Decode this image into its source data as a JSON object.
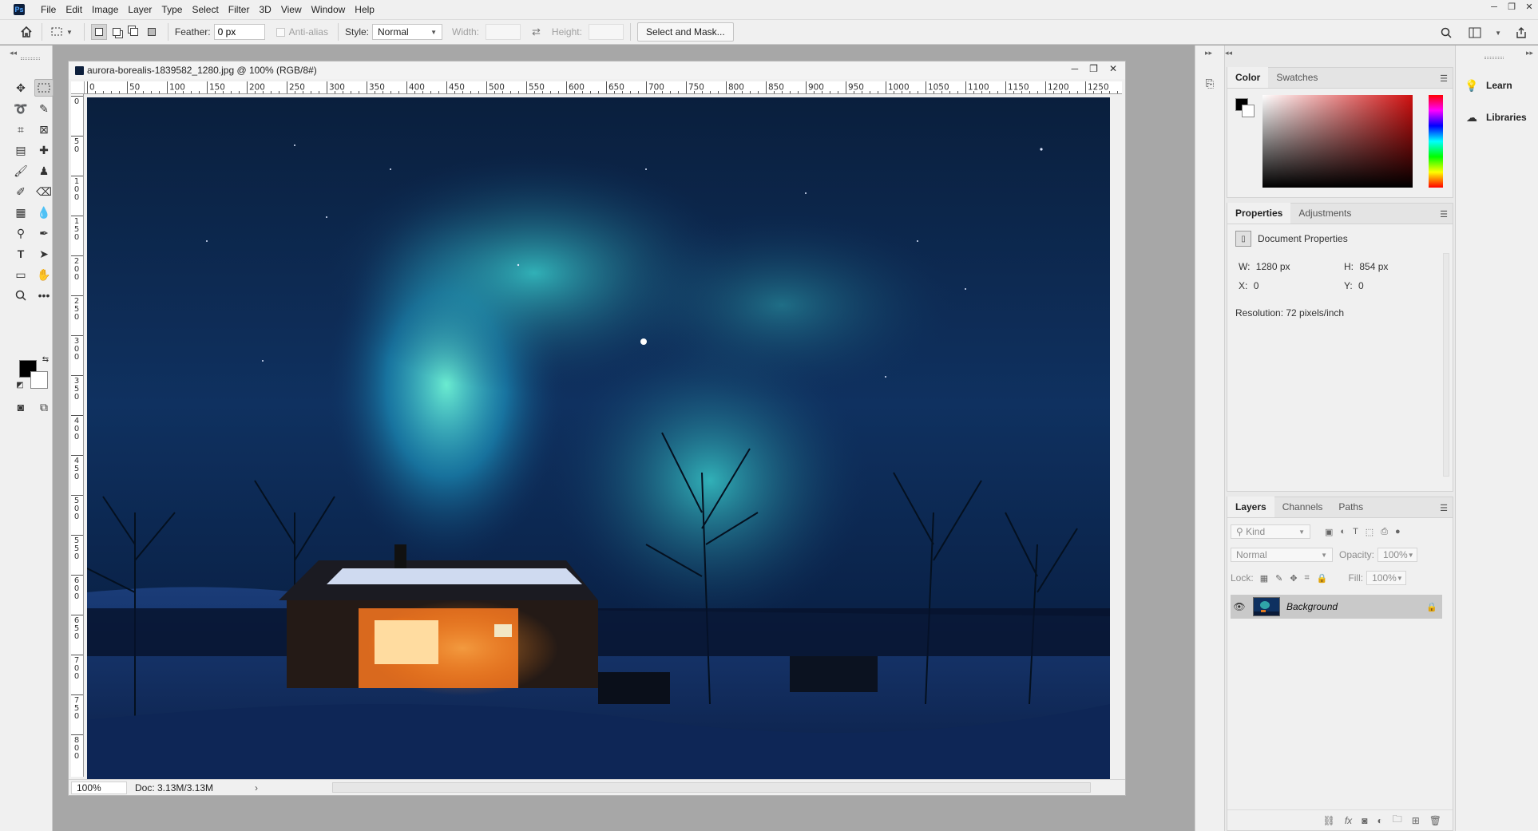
{
  "app": {
    "logo_text": "Ps"
  },
  "menu": [
    "File",
    "Edit",
    "Image",
    "Layer",
    "Type",
    "Select",
    "Filter",
    "3D",
    "View",
    "Window",
    "Help"
  ],
  "window_controls": {
    "minimize": "─",
    "restore": "❐",
    "close": "✕"
  },
  "options": {
    "feather_label": "Feather:",
    "feather_value": "0 px",
    "antialias_label": "Anti-alias",
    "style_label": "Style:",
    "style_value": "Normal",
    "width_label": "Width:",
    "height_label": "Height:",
    "select_mask_label": "Select and Mask..."
  },
  "document": {
    "title": "aurora-borealis-1839582_1280.jpg @ 100% (RGB/8#)",
    "zoom": "100%",
    "doc_info": "Doc: 3.13M/3.13M",
    "ruler_h": [
      "0",
      "50",
      "100",
      "150",
      "200",
      "250",
      "300",
      "350",
      "400",
      "450",
      "500",
      "550",
      "600",
      "650",
      "700",
      "750",
      "800",
      "850",
      "900",
      "950",
      "1000",
      "1050",
      "1100",
      "1150",
      "1200",
      "1250"
    ],
    "ruler_v": [
      "0",
      "50",
      "100",
      "150",
      "200",
      "250",
      "300",
      "350",
      "400",
      "450",
      "500",
      "550",
      "600",
      "650",
      "700",
      "750",
      "800"
    ]
  },
  "color_panel": {
    "tabs": [
      "Color",
      "Swatches"
    ]
  },
  "properties_panel": {
    "tabs": [
      "Properties",
      "Adjustments"
    ],
    "section_title": "Document Properties",
    "w_label": "W:",
    "w_value": "1280 px",
    "h_label": "H:",
    "h_value": "854 px",
    "x_label": "X:",
    "x_value": "0",
    "y_label": "Y:",
    "y_value": "0",
    "resolution": "Resolution: 72 pixels/inch"
  },
  "layers_panel": {
    "tabs": [
      "Layers",
      "Channels",
      "Paths"
    ],
    "kind_placeholder": "Kind",
    "blend_mode": "Normal",
    "opacity_label": "Opacity:",
    "opacity_value": "100%",
    "lock_label": "Lock:",
    "fill_label": "Fill:",
    "fill_value": "100%",
    "layer_name": "Background"
  },
  "learn_panel": {
    "items": [
      "Learn",
      "Libraries"
    ]
  },
  "colors": {
    "accent_red": "#d01010",
    "canvas_sky": "#0c2a4e",
    "aurora": "#3fd6c8"
  }
}
